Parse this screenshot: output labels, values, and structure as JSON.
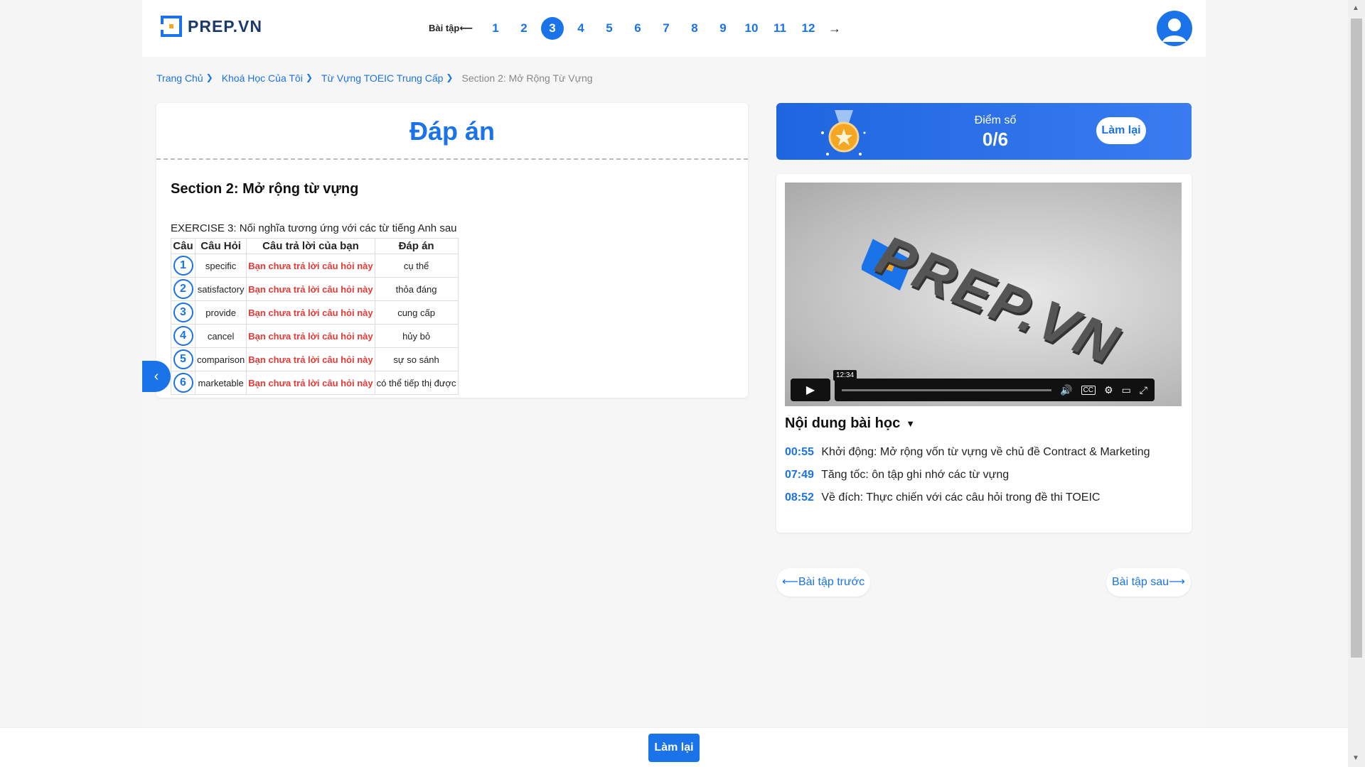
{
  "header": {
    "logo_text": "PREP.VN",
    "pager_label": "Bài tập",
    "pages": [
      "1",
      "2",
      "3",
      "4",
      "5",
      "6",
      "7",
      "8",
      "9",
      "10",
      "11",
      "12"
    ],
    "active_page": "3",
    "next_arrow": "→"
  },
  "breadcrumb": {
    "items": [
      "Trang Chủ",
      "Khoá Học Của Tôi",
      "Từ Vựng TOEIC Trung Cấp"
    ],
    "current": "Section 2: Mở Rộng Từ Vựng"
  },
  "answer": {
    "title": "Đáp án",
    "section_title": "Section 2: Mở rộng từ vựng",
    "exercise_title": "EXERCISE 3: Nối nghĩa tương ứng với các từ tiếng Anh sau",
    "columns": [
      "Câu",
      "Câu Hỏi",
      "Câu trả lời của bạn",
      "Đáp án"
    ],
    "rows": [
      {
        "num": "1",
        "question": "specific",
        "your_answer": "Bạn chưa trả lời câu hỏi này",
        "answer": "cụ thể"
      },
      {
        "num": "2",
        "question": "satisfactory",
        "your_answer": "Bạn chưa trả lời câu hỏi này",
        "answer": "thỏa đáng"
      },
      {
        "num": "3",
        "question": "provide",
        "your_answer": "Bạn chưa trả lời câu hỏi này",
        "answer": "cung cấp"
      },
      {
        "num": "4",
        "question": "cancel",
        "your_answer": "Bạn chưa trả lời câu hỏi này",
        "answer": "hủy bỏ"
      },
      {
        "num": "5",
        "question": "comparison",
        "your_answer": "Bạn chưa trả lời câu hỏi này",
        "answer": "sự so sánh"
      },
      {
        "num": "6",
        "question": "marketable",
        "your_answer": "Bạn chưa trả lời câu hỏi này",
        "answer": "có thể tiếp thị được"
      }
    ]
  },
  "score": {
    "label": "Điểm số",
    "value": "0/6",
    "retry_label": "Làm lại"
  },
  "video": {
    "brand_text": "PREP.VN",
    "tooltip_time": "12:34",
    "play_icon": "play-icon"
  },
  "content": {
    "heading": "Nội dung bài học",
    "chapters": [
      {
        "time": "00:55",
        "title": "Khởi động: Mở rộng vốn từ vựng về chủ đề Contract & Marketing"
      },
      {
        "time": "07:49",
        "title": "Tăng tốc: ôn tập ghi nhớ các từ vựng"
      },
      {
        "time": "08:52",
        "title": "Về đích: Thực chiến với các câu hỏi trong đề thi TOEIC"
      }
    ]
  },
  "nav": {
    "prev_label": "⟵Bài tập trước",
    "next_label": "Bài tập sau⟶"
  },
  "footer": {
    "retry_label": "Làm lại"
  },
  "colors": {
    "accent": "#1a73e8",
    "error": "#e53935"
  }
}
